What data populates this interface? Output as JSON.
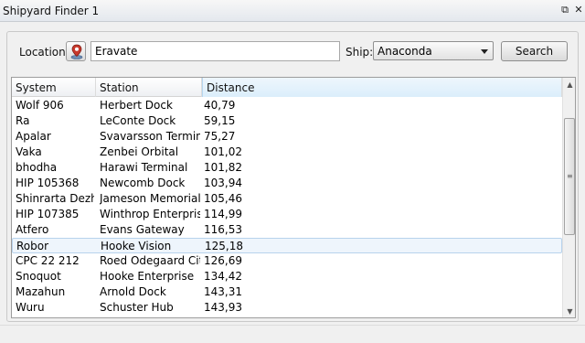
{
  "window": {
    "title": "Shipyard Finder 1"
  },
  "location": {
    "label": "Location:",
    "value": "Eravate"
  },
  "ship": {
    "label": "Ship:",
    "selected": "Anaconda"
  },
  "search_label": "Search",
  "table": {
    "columns": [
      "System",
      "Station",
      "Distance"
    ],
    "rows": [
      [
        "Wolf 906",
        "Herbert Dock",
        "40,79"
      ],
      [
        "Ra",
        "LeConte Dock",
        "59,15"
      ],
      [
        "Apalar",
        "Svavarsson Terminal",
        "75,27"
      ],
      [
        "Vaka",
        "Zenbei Orbital",
        "101,02"
      ],
      [
        "bhodha",
        "Harawi Terminal",
        "101,82"
      ],
      [
        "HIP 105368",
        "Newcomb Dock",
        "103,94"
      ],
      [
        "Shinrarta Dezhra",
        "Jameson Memorial",
        "105,46"
      ],
      [
        "HIP 107385",
        "Winthrop Enterprise",
        "114,99"
      ],
      [
        "Atfero",
        "Evans Gateway",
        "116,53"
      ],
      [
        "Robor",
        "Hooke Vision",
        "125,18"
      ],
      [
        "CPC 22 212",
        "Roed Odegaard City",
        "126,69"
      ],
      [
        "Snoquot",
        "Hooke Enterprise",
        "134,42"
      ],
      [
        "Mazahun",
        "Arnold Dock",
        "143,31"
      ],
      [
        "Wuru",
        "Schuster Hub",
        "143,93"
      ]
    ],
    "selected_row": 9
  },
  "icons": {
    "restore": "restore-icon",
    "close": "close-icon",
    "location_pin": "location-pin-icon",
    "dropdown": "chevron-down-icon"
  }
}
